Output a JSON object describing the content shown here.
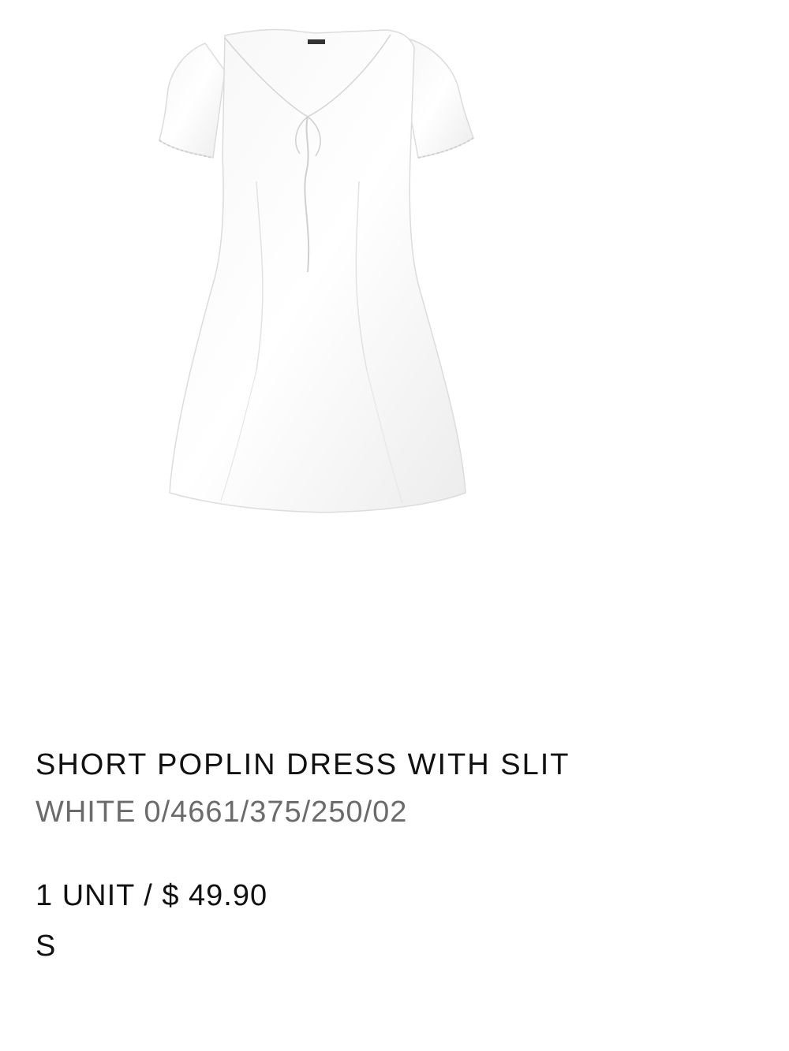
{
  "product": {
    "image_alt": "SHORT POPLIN DRESS WITH SLIT",
    "title": "SHORT POPLIN DRESS WITH SLIT",
    "color": "WHITE",
    "reference": "0/4661/375/250/02",
    "quantity_price": "1 UNIT / $ 49.90",
    "size": "S"
  },
  "colors": {
    "title": "#111111",
    "reference": "#6b6b6b",
    "background": "#ffffff"
  }
}
